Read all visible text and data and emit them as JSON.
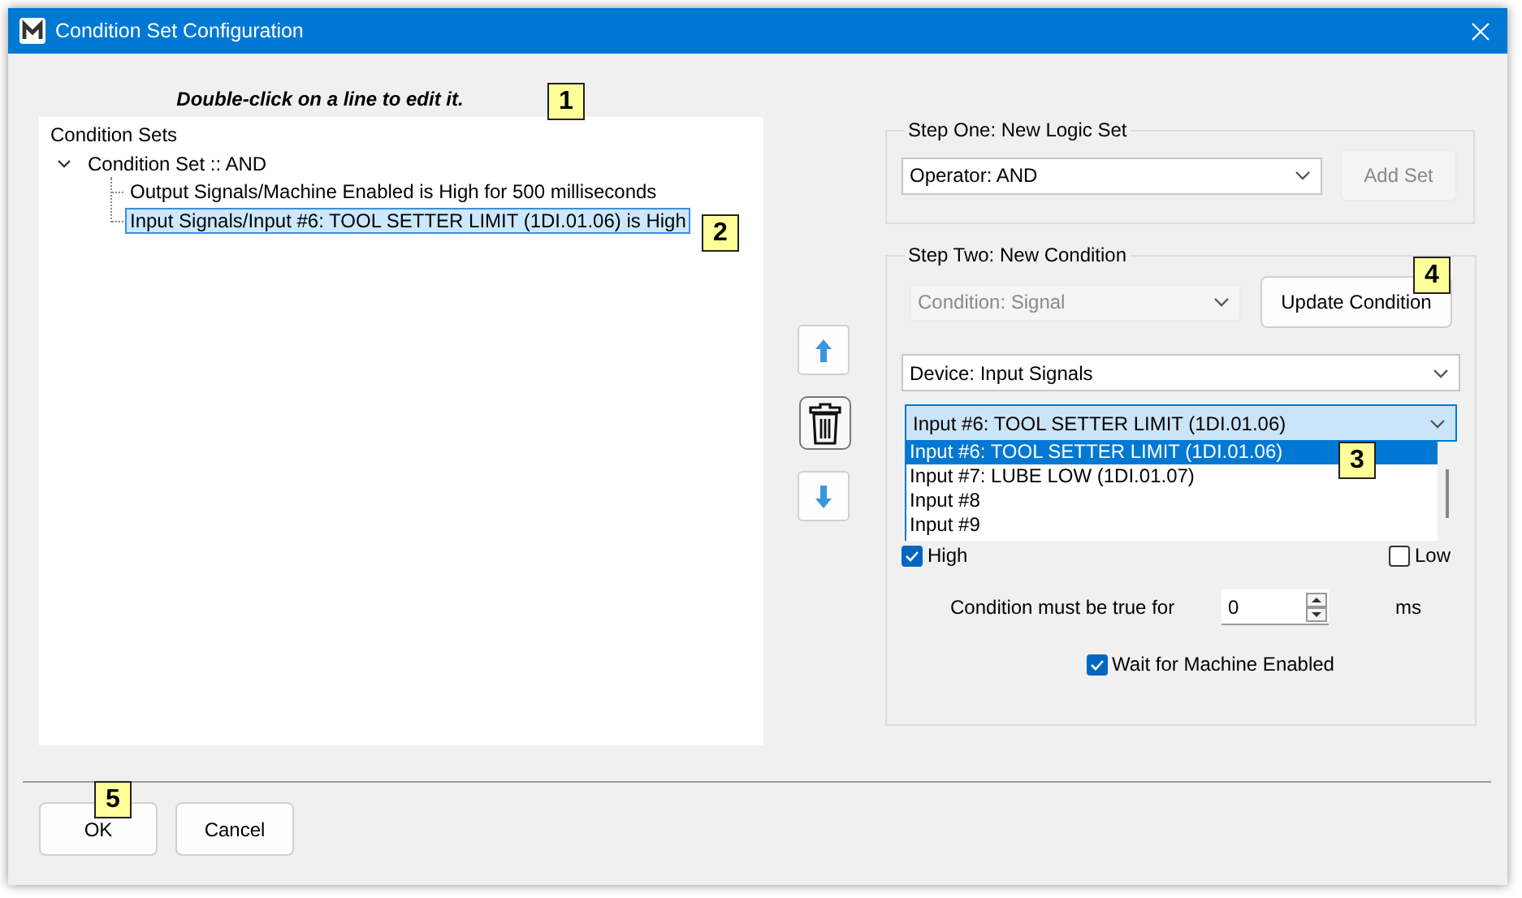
{
  "window": {
    "title": "Condition Set Configuration"
  },
  "hint": "Double-click on a line to edit it.",
  "tree": {
    "items": [
      {
        "label": "Condition Sets",
        "children": [
          {
            "label": "Condition Set :: AND",
            "expanded": true,
            "selected": false,
            "children": [
              {
                "label": "Output Signals/Machine Enabled is High for 500 milliseconds",
                "selected": false
              },
              {
                "label": "Input Signals/Input #6: TOOL SETTER LIMIT (1DI.01.06) is High",
                "selected": true
              }
            ]
          }
        ]
      }
    ]
  },
  "step_one": {
    "legend": "Step One: New Logic Set",
    "operator": {
      "value": "Operator: AND"
    },
    "add_button": {
      "label": "Add Set",
      "disabled": true
    }
  },
  "step_two": {
    "legend": "Step Two: New Condition",
    "condition": {
      "value": "Condition: Signal",
      "disabled": true
    },
    "update_button": {
      "label": "Update Condition",
      "disabled": false
    },
    "device": {
      "value": "Device: Input Signals"
    },
    "input": {
      "value": "Input #6: TOOL SETTER LIMIT (1DI.01.06)",
      "expanded": true,
      "options": [
        {
          "label": "Input #6: TOOL SETTER LIMIT (1DI.01.06)",
          "selected": true
        },
        {
          "label": "Input #7: LUBE LOW (1DI.01.07)",
          "selected": false
        },
        {
          "label": "Input #8",
          "selected": false
        },
        {
          "label": "Input #9",
          "selected": false
        }
      ]
    },
    "high": {
      "label": "High",
      "checked": true
    },
    "low": {
      "label": "Low",
      "checked": false
    },
    "duration": {
      "label": "Condition must be true for",
      "value": "0",
      "unit": "ms"
    },
    "wait": {
      "label": "Wait for Machine Enabled",
      "checked": true
    }
  },
  "buttons": [
    {
      "label": "OK"
    },
    {
      "label": "Cancel"
    }
  ],
  "callouts": [
    {
      "number": "1"
    },
    {
      "number": "2"
    },
    {
      "number": "3"
    },
    {
      "number": "4"
    },
    {
      "number": "5"
    }
  ]
}
